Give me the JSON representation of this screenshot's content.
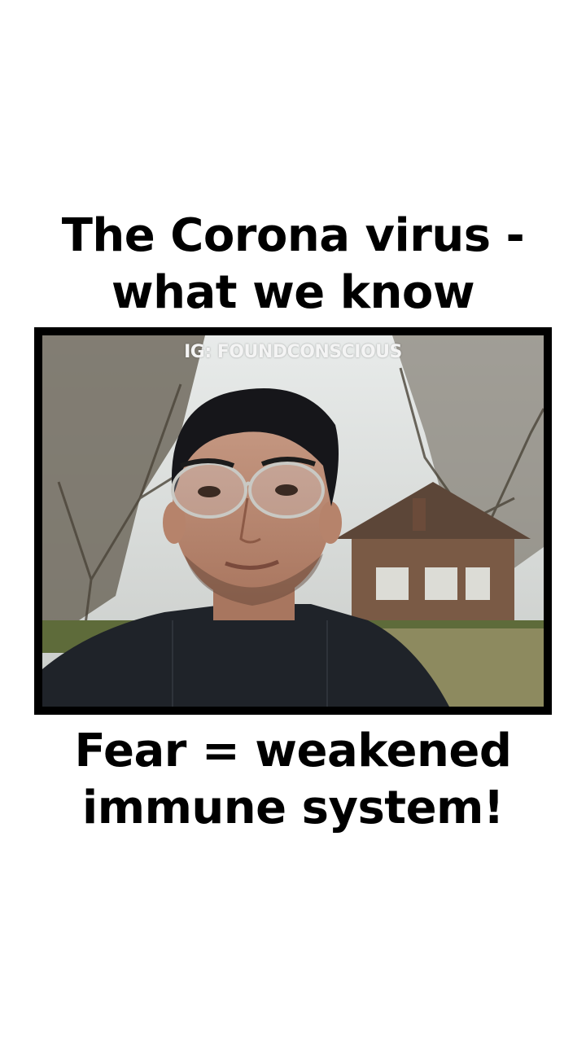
{
  "title": {
    "line1": "The Corona virus -",
    "line2": "what we know"
  },
  "video": {
    "watermark": "IG: FOUNDCONSCIOUS",
    "subject": "person-with-glasses-outdoors"
  },
  "caption": {
    "line1": "Fear = weakened",
    "line2": "immune system!"
  },
  "colors": {
    "background": "#ffffff",
    "text": "#000000",
    "frame": "#000000"
  }
}
